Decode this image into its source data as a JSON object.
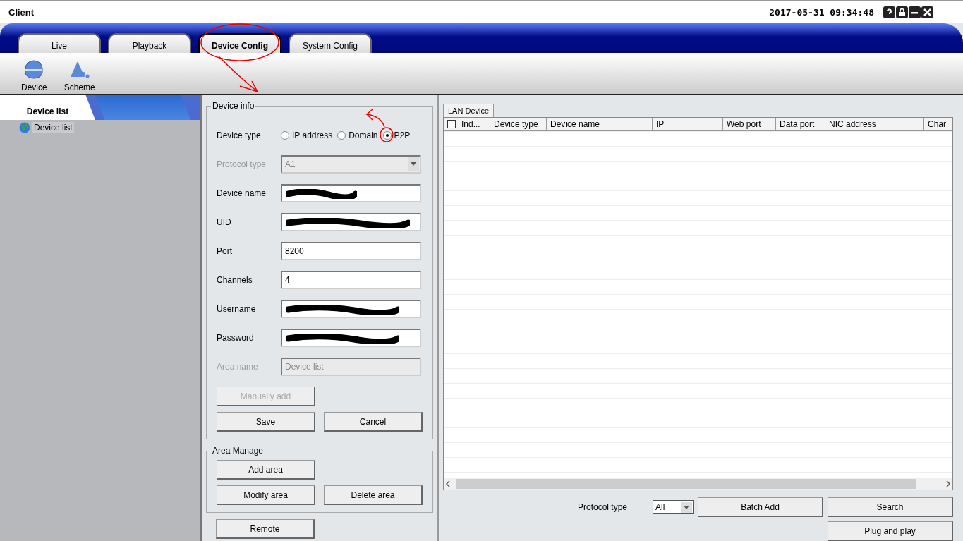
{
  "window": {
    "title": "Client",
    "datetime": "2017-05-31 09:34:48"
  },
  "main_tabs": [
    {
      "label": "Live",
      "selected": false
    },
    {
      "label": "Playback",
      "selected": false
    },
    {
      "label": "Device Config",
      "selected": true
    },
    {
      "label": "System Config",
      "selected": false
    }
  ],
  "toolbar": [
    {
      "label": "Device",
      "kind": "device"
    },
    {
      "label": "Scheme",
      "kind": "scheme"
    }
  ],
  "sidebar": {
    "tabs": [
      {
        "label": "Device list",
        "selected": true
      }
    ],
    "tree": [
      {
        "label": "Device list"
      }
    ]
  },
  "device_info": {
    "title": "Device info",
    "device_type": {
      "label": "Device type",
      "options": [
        {
          "label": "IP address",
          "selected": false
        },
        {
          "label": "Domain",
          "selected": false
        },
        {
          "label": "P2P",
          "selected": true
        }
      ]
    },
    "fields": [
      {
        "label": "Protocol type",
        "kind": "select",
        "value": "A1",
        "disabled": true
      },
      {
        "label": "Device name",
        "kind": "text",
        "redacted": true,
        "disabled": false
      },
      {
        "label": "UID",
        "kind": "text",
        "redacted": true,
        "disabled": false
      },
      {
        "label": "Port",
        "kind": "text",
        "value": "8200",
        "disabled": false
      },
      {
        "label": "Channels",
        "kind": "text",
        "value": "4",
        "disabled": false
      },
      {
        "label": "Username",
        "kind": "text",
        "redacted": true,
        "disabled": false
      },
      {
        "label": "Password",
        "kind": "text",
        "redacted": true,
        "disabled": false
      },
      {
        "label": "Area name",
        "kind": "text",
        "value": "Device list",
        "disabled": true
      }
    ],
    "buttons": [
      {
        "label": "Manually add",
        "disabled": true
      },
      {
        "label": "Save",
        "disabled": false
      },
      {
        "label": "Cancel",
        "disabled": false
      }
    ]
  },
  "area_manage": {
    "title": "Area Manage",
    "buttons": [
      {
        "label": "Add area"
      },
      {
        "label": "Modify area"
      },
      {
        "label": "Delete area"
      }
    ]
  },
  "remote_button": "Remote",
  "lan": {
    "tab": "LAN Device",
    "columns": [
      "Ind...",
      "Device type",
      "Device name",
      "IP",
      "Web port",
      "Data port",
      "NIC address",
      "Char"
    ],
    "select_all_checked": false,
    "protocol_label": "Protocol type",
    "protocol_value": "All",
    "buttons": [
      "Batch Add",
      "Search",
      "Plug and play"
    ]
  }
}
